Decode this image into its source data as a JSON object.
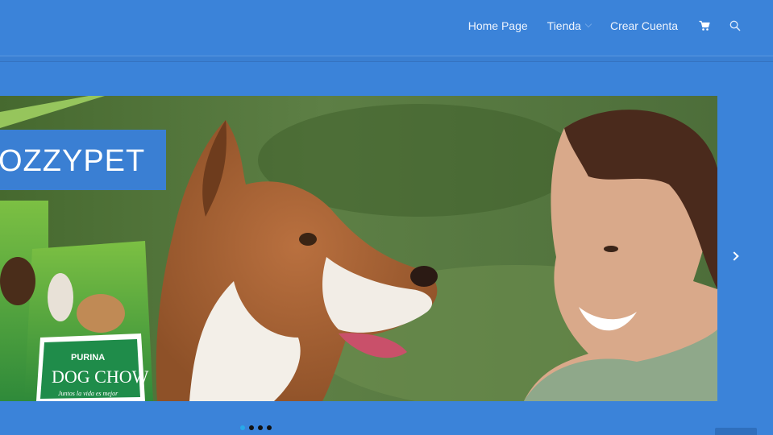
{
  "nav": {
    "items": [
      {
        "label": "Home Page"
      },
      {
        "label": "Tienda",
        "has_submenu": true
      },
      {
        "label": "Crear Cuenta"
      }
    ],
    "cart_icon": "cart-icon",
    "search_icon": "search-icon"
  },
  "slider": {
    "banner_text": "OZZYPET",
    "product_brand": "PURINA",
    "product_name": "DOG CHOW",
    "product_tagline": "Juntos la vida es mejor",
    "dots": [
      {
        "active": true
      },
      {
        "active": false
      },
      {
        "active": false
      },
      {
        "active": false
      }
    ]
  },
  "colors": {
    "background": "#3b83d9",
    "active_dot": "#28a9e9",
    "banner_blue": "#3a7fd3"
  }
}
